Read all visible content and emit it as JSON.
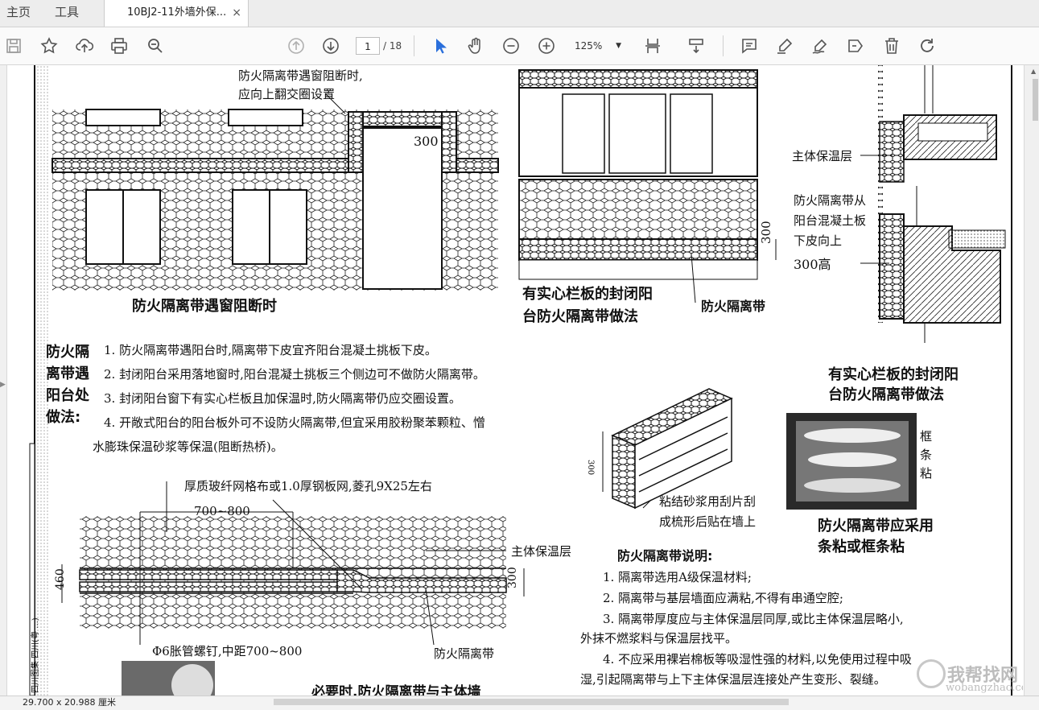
{
  "tabs": {
    "home": "主页",
    "tools": "工具",
    "document": "10BJ2-11外墙外保...",
    "close": "×"
  },
  "toolbar": {
    "page_current": "1",
    "page_total": "/ 18",
    "zoom": "125%",
    "icons": [
      "save-icon",
      "bookmark-star-icon",
      "upload-icon",
      "print-icon",
      "find-icon",
      "prev-page-icon",
      "next-page-icon",
      "select-cursor-icon",
      "hand-tool-icon",
      "zoom-out-icon",
      "zoom-in-icon",
      "fit-page-icon",
      "scroll-mode-icon",
      "comment-icon",
      "highlight-icon",
      "sign-icon",
      "fill-sign-icon",
      "delete-icon",
      "rotate-icon"
    ]
  },
  "status": {
    "page_size": "29.700 x 20.988 厘米"
  },
  "drawing": {
    "note_window_1": "防火隔离带遇窗阻断时,",
    "note_window_2": "应向上翻交圈设置",
    "dim_300_a": "300",
    "title_window": "防火隔离带遇窗阻断时",
    "title_balcony_1": "有实心栏板的封闭阳",
    "title_balcony_2": "台防火隔离带做法",
    "label_band_a": "防火隔离带",
    "dim_300_b": "300",
    "label_main_insul": "主体保温层",
    "note_slab_1": "防火隔离带从",
    "note_slab_2": "阳台混凝土板",
    "note_slab_3": "下皮向上",
    "note_slab_4": "300高",
    "title_section_1": "有实心栏板的封闭阳",
    "title_section_2": "台防火隔离带做法",
    "side_heading": [
      "防火隔",
      "离带遇",
      "阳台处",
      "做法:"
    ],
    "items": [
      "1. 防火隔离带遇阳台时,隔离带下皮宜齐阳台混凝土挑板下皮。",
      "2. 封闭阳台采用落地窗时,阳台混凝土挑板三个侧边可不做防火隔离带。",
      "3. 封闭阳台窗下有实心栏板且加保温时,防火隔离带仍应交圈设置。",
      "4. 开敞式阳台的阳台板外可不设防火隔离带,但宜采用胶粉聚苯颗粒、憎",
      "水膨珠保温砂浆等保温(阻断热桥)。"
    ],
    "mesh_note": "厚质玻纤网格布或1.0厚钢板网,菱孔9X25左右",
    "dim_700_800": "700~800",
    "label_main_insul_2": "主体保温层",
    "dim_460": "460",
    "dim_300_c": "300",
    "anchor_note": "Φ6胀管螺钉,中距700~800",
    "label_band_b": "防火隔离带",
    "title_wall": "必要时,防火隔离带与主体墙",
    "block_dim": "300",
    "block_note_1": "粘结砂浆用刮片刮",
    "block_note_2": "成梳形后贴在墙上",
    "frame_label": [
      "框",
      "条",
      "粘"
    ],
    "title_frame_1": "防火隔离带应采用",
    "title_frame_2": "条粘或框条粘",
    "explain_title": "防火隔离带说明:",
    "explain": [
      "1. 隔离带选用A级保温材料;",
      "2. 隔离带与基层墙面应满粘,不得有串通空腔;",
      "3. 隔离带厚度应与主体保温层同厚,或比主体保温层略小,",
      "外抹不燃浆料与保温层找平。",
      "4. 不应采用裸岩棉板等吸湿性强的材料,以免使用过程中吸",
      "湿,引起隔离带与上下主体保温层连接处产生变形、裂缝。"
    ],
    "side_strip": "四川图集 四川(粤 ...)"
  },
  "watermark": {
    "cn": "我帮找网",
    "url": "wobangzhao.com"
  }
}
